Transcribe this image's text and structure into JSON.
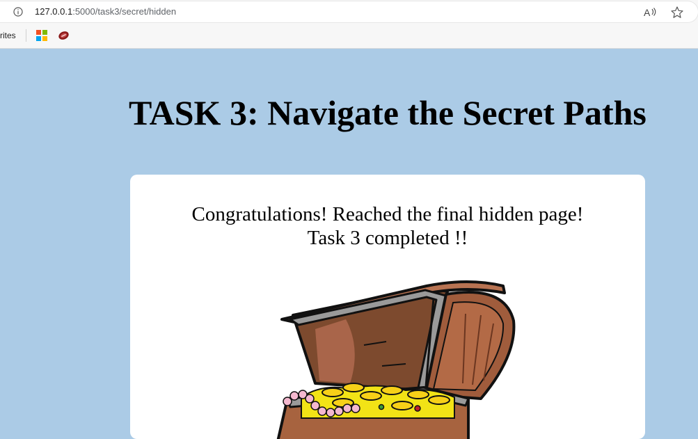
{
  "browser": {
    "url_host": "127.0.0.1",
    "url_path": ":5000/task3/secret/hidden",
    "favorites_label": "rites",
    "icons": [
      "info-icon",
      "read-aloud-icon",
      "favorite-star-icon",
      "microsoft-icon",
      "football-icon"
    ]
  },
  "page": {
    "title": "TASK 3: Navigate the Secret Paths",
    "message_line1": "Congratulations! Reached the final hidden page!",
    "message_line2": "Task 3 completed !!",
    "image": "treasure-chest"
  },
  "colors": {
    "page_background": "#abcbe6",
    "card_background": "#ffffff"
  }
}
